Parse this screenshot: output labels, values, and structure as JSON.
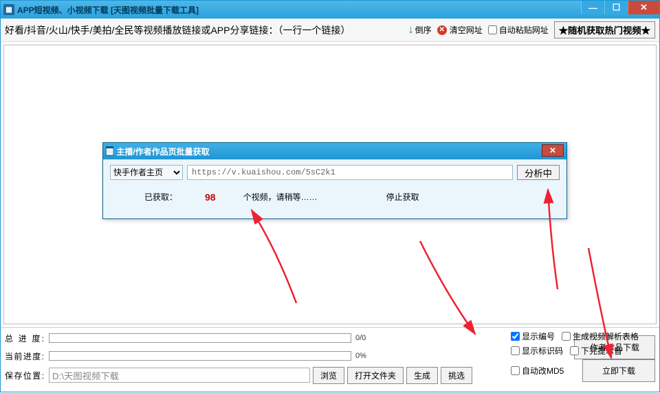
{
  "window": {
    "title": "APP短视频、小视频下载  [天图视频批量下载工具]"
  },
  "toolbar": {
    "hint": "好看/抖音/火山/快手/美拍/全民等视频播放链接或APP分享链接：（一行一个链接）",
    "reverse_label": "倒序",
    "clear_label": "清空网址",
    "autopaste_label": "自动粘贴网址",
    "random_hot_label": "★随机获取热门视频★"
  },
  "bottom": {
    "total_progress_label": "总 进 度:",
    "total_progress_text": "0/0",
    "current_progress_label": "当前进度:",
    "current_progress_text": "0%",
    "save_path_label": "保存位置:",
    "save_path_value": "D:\\天图视频下载",
    "browse_label": "浏览",
    "open_folder_label": "打开文件夹",
    "generate_label": "生成",
    "pick_label": "挑选",
    "author_download_label": "作者作品下载",
    "show_index_label": "显示编号",
    "show_idcode_label": "显示标识码",
    "auto_md5_label": "自动改MD5",
    "gen_parse_table_label": "生成视频解析表格",
    "done_sound_label": "下完提示音",
    "download_now_label": "立即下载"
  },
  "modal": {
    "title": "主播/作者作品页批量获取",
    "source_selected": "快手作者主页",
    "url_value": "https://v.kuaishou.com/5sC2k1",
    "analyze_label": "分析中",
    "got_label": "已获取：",
    "count": "98",
    "videos_wait_label": "个视频，请稍等……",
    "stop_label": "停止获取"
  }
}
